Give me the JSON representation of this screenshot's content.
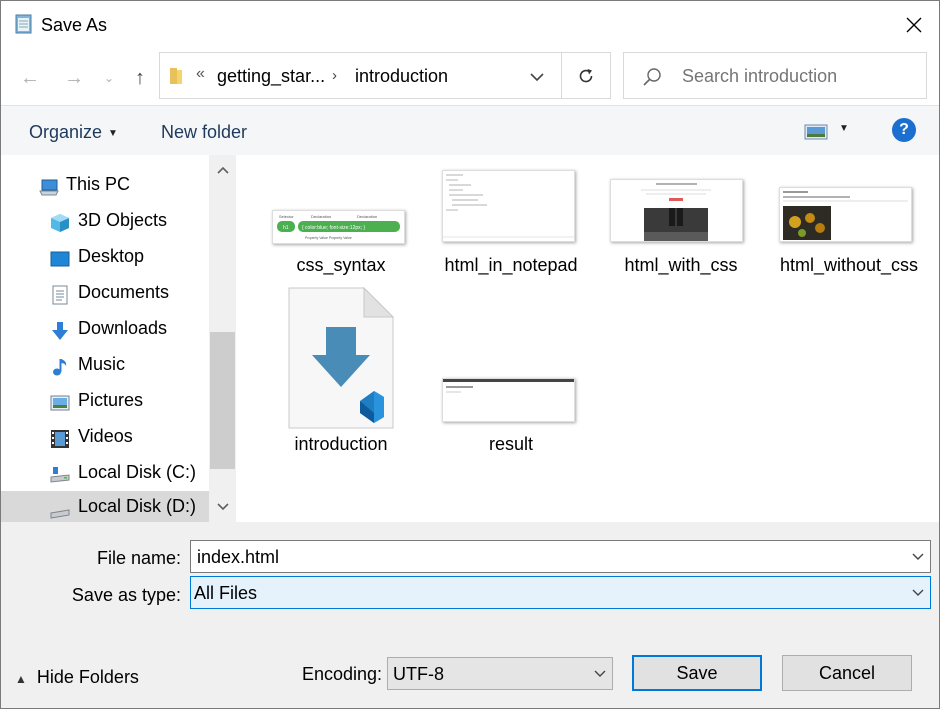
{
  "window": {
    "title": "Save As"
  },
  "address": {
    "overflow": "«",
    "segment1": "getting_star...",
    "segment2": "introduction"
  },
  "search": {
    "placeholder": "Search introduction"
  },
  "toolbar": {
    "organize_label": "Organize",
    "new_folder_label": "New folder",
    "help_label": "?"
  },
  "sidebar": {
    "items": [
      {
        "label": "This PC",
        "icon": "computer-icon"
      },
      {
        "label": "3D Objects",
        "icon": "cube-icon"
      },
      {
        "label": "Desktop",
        "icon": "desktop-icon"
      },
      {
        "label": "Documents",
        "icon": "documents-icon"
      },
      {
        "label": "Downloads",
        "icon": "download-icon"
      },
      {
        "label": "Music",
        "icon": "music-icon"
      },
      {
        "label": "Pictures",
        "icon": "pictures-icon"
      },
      {
        "label": "Videos",
        "icon": "videos-icon"
      },
      {
        "label": "Local Disk (C:)",
        "icon": "disk-icon"
      },
      {
        "label": "Local Disk (D:)",
        "icon": "disk-icon"
      }
    ]
  },
  "files": [
    {
      "name": "css_syntax"
    },
    {
      "name": "html_in_notepad"
    },
    {
      "name": "html_with_css"
    },
    {
      "name": "html_without_css"
    },
    {
      "name": "introduction"
    },
    {
      "name": "result"
    }
  ],
  "form": {
    "file_name_label": "File name:",
    "file_name_value": "index.html",
    "save_type_label": "Save as type:",
    "save_type_value": "All Files",
    "encoding_label": "Encoding:",
    "encoding_value": "UTF-8"
  },
  "buttons": {
    "hide_folders": "Hide Folders",
    "save": "Save",
    "cancel": "Cancel"
  },
  "colors": {
    "accent": "#0078d7",
    "selected": "#d9d9d9",
    "help": "#1a6fd1"
  }
}
